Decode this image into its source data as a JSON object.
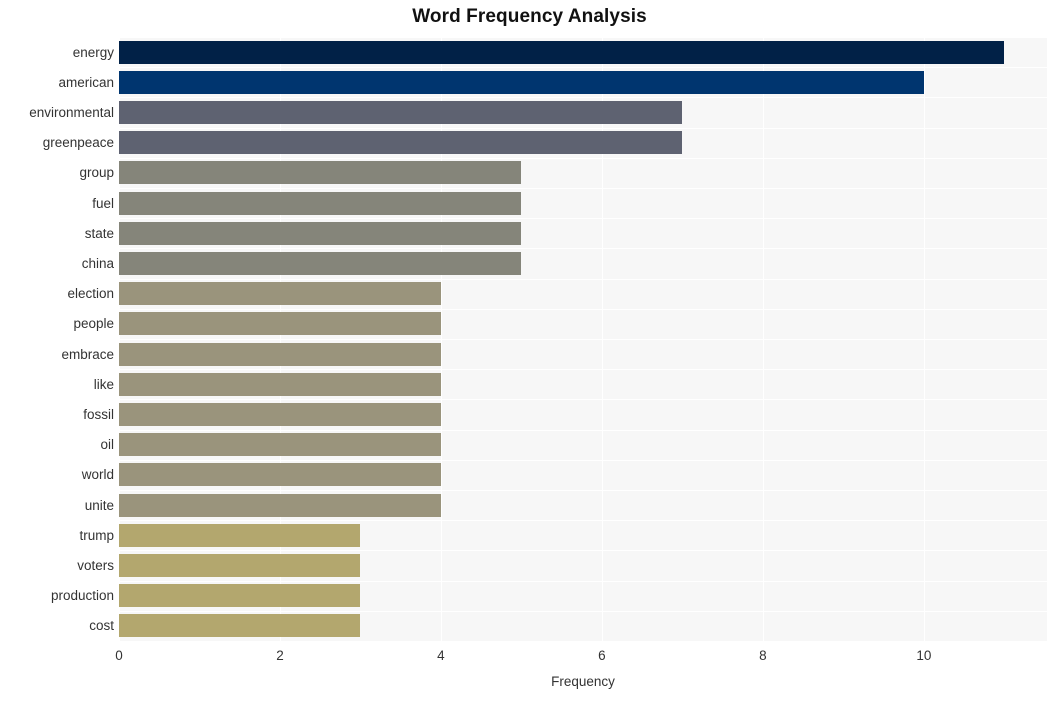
{
  "chart_data": {
    "type": "bar",
    "orientation": "horizontal",
    "title": "Word Frequency Analysis",
    "xlabel": "Frequency",
    "ylabel": "",
    "xlim": [
      0,
      11.53
    ],
    "xticks": [
      0,
      2,
      4,
      6,
      8,
      10
    ],
    "grid": true,
    "legend": null,
    "categories": [
      "energy",
      "american",
      "environmental",
      "greenpeace",
      "group",
      "fuel",
      "state",
      "china",
      "election",
      "people",
      "embrace",
      "like",
      "fossil",
      "oil",
      "world",
      "unite",
      "trump",
      "voters",
      "production",
      "cost"
    ],
    "values": [
      11,
      10,
      7,
      7,
      5,
      5,
      5,
      5,
      4,
      4,
      4,
      4,
      4,
      4,
      4,
      4,
      3,
      3,
      3,
      3
    ],
    "bar_colors": [
      "#012147",
      "#00356f",
      "#5e6271",
      "#5e6271",
      "#85857a",
      "#85857a",
      "#85857a",
      "#85857a",
      "#9a947c",
      "#9a947c",
      "#9a947c",
      "#9a947c",
      "#9a947c",
      "#9a947c",
      "#9a947c",
      "#9a947c",
      "#b3a76e",
      "#b3a76e",
      "#b3a76e",
      "#b3a76e"
    ]
  },
  "style": {
    "figure_background": "#ffffff",
    "plot_background": "#f7f7f7",
    "grid_color": "#ffffff",
    "text_color": "#333333",
    "title_color": "#111111"
  }
}
